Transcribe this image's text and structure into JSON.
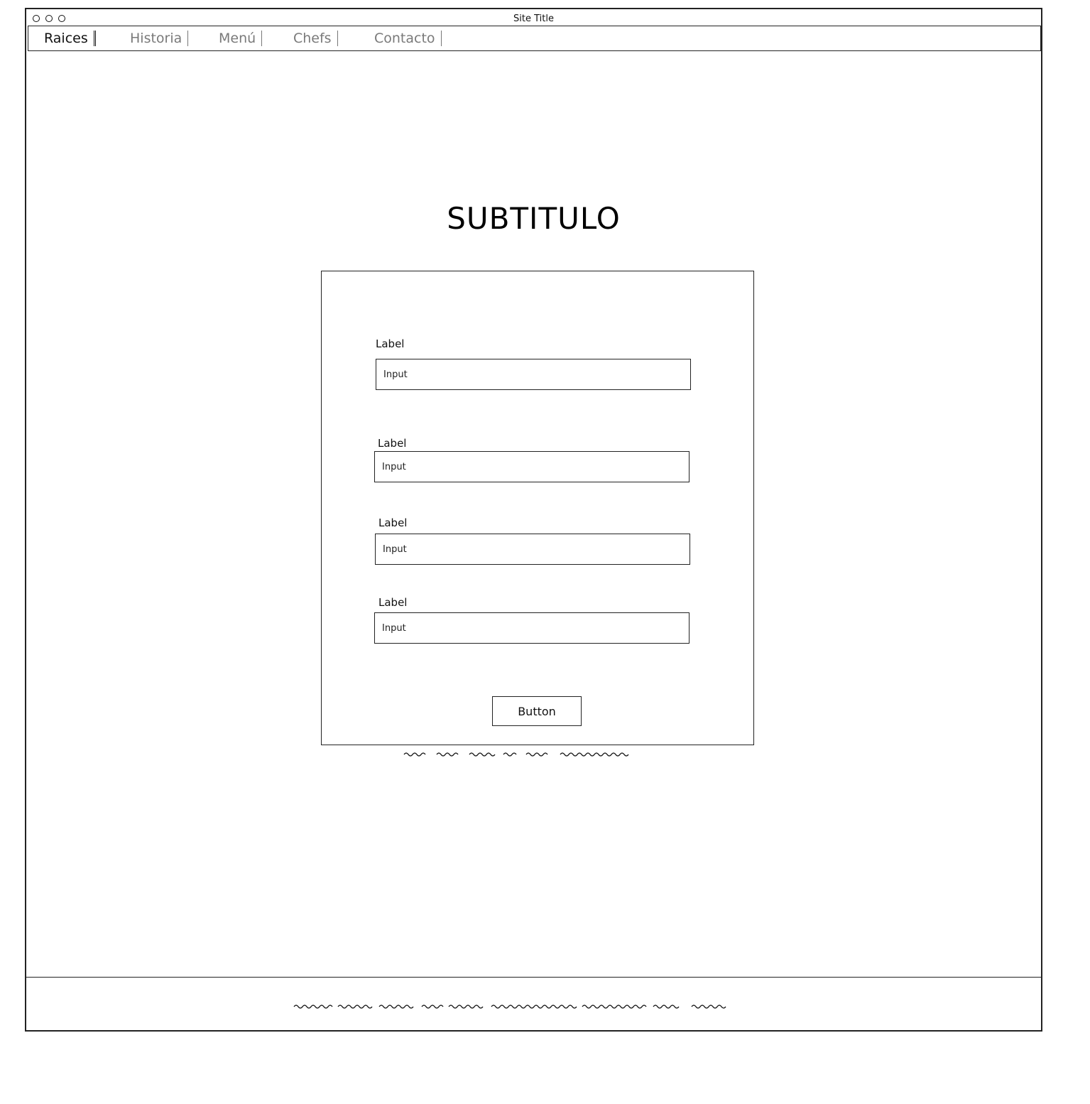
{
  "window": {
    "title": "Site Title"
  },
  "nav": {
    "items": [
      {
        "label": "Raices",
        "active": true
      },
      {
        "label": "Historia",
        "active": false
      },
      {
        "label": "Menú",
        "active": false
      },
      {
        "label": "Chefs",
        "active": false
      },
      {
        "label": "Contacto",
        "active": false
      }
    ]
  },
  "main": {
    "subtitle": "SUBTITULO",
    "form": {
      "fields": [
        {
          "label": "Label",
          "placeholder": "Input"
        },
        {
          "label": "Label",
          "placeholder": "Input"
        },
        {
          "label": "Label",
          "placeholder": "Input"
        },
        {
          "label": "Label",
          "placeholder": "Input"
        }
      ],
      "button_label": "Button"
    }
  }
}
